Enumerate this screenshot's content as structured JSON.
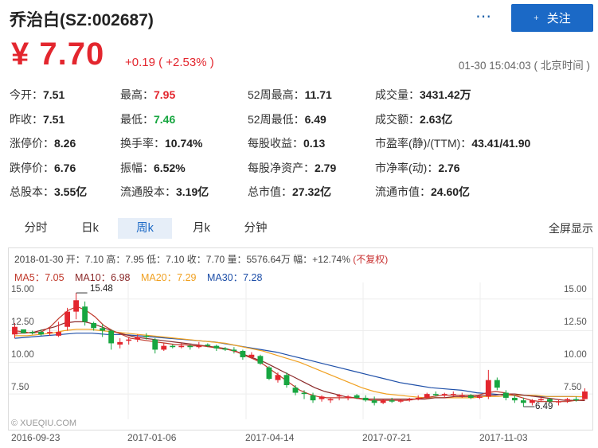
{
  "header": {
    "title": "乔治白(SZ:002687)",
    "more_icon": "⋯",
    "follow_label": "关注",
    "follow_icon": "+",
    "price": "¥ 7.70",
    "change": "+0.19 ( +2.53% )",
    "time": "01-30 15:04:03 ( 北京时间 )"
  },
  "stats": [
    [
      [
        "今开：",
        "7.51",
        ""
      ],
      [
        "最高：",
        "7.95",
        "red"
      ],
      [
        "52周最高：",
        "11.71",
        ""
      ],
      [
        "成交量：",
        "3431.42万",
        ""
      ]
    ],
    [
      [
        "昨收：",
        "7.51",
        ""
      ],
      [
        "最低：",
        "7.46",
        "grn"
      ],
      [
        "52周最低：",
        "6.49",
        ""
      ],
      [
        "成交额：",
        "2.63亿",
        ""
      ]
    ],
    [
      [
        "涨停价：",
        "8.26",
        ""
      ],
      [
        "换手率：",
        "10.74%",
        ""
      ],
      [
        "每股收益：",
        "0.13",
        ""
      ],
      [
        "市盈率(静)/(TTM)：",
        "43.41/41.90",
        ""
      ]
    ],
    [
      [
        "跌停价：",
        "6.76",
        ""
      ],
      [
        "振幅：",
        "6.52%",
        ""
      ],
      [
        "每股净资产：",
        "2.79",
        ""
      ],
      [
        "市净率(动)：",
        "2.76",
        ""
      ]
    ],
    [
      [
        "总股本：",
        "3.55亿",
        ""
      ],
      [
        "流通股本：",
        "3.19亿",
        ""
      ],
      [
        "总市值：",
        "27.32亿",
        ""
      ],
      [
        "流通市值：",
        "24.60亿",
        ""
      ]
    ]
  ],
  "tabs": [
    "分时",
    "日k",
    "周k",
    "月k",
    "分钟"
  ],
  "active_tab": "周k",
  "fullscreen": "全屏显示",
  "chart_info": {
    "line": "2018-01-30 开：7.10 高：7.95 低：7.10 收：7.70 量：5576.64万 幅：+12.74%",
    "adjust": "(不复权)",
    "ma": [
      {
        "label": "MA5：7.05",
        "color": "#c0392b"
      },
      {
        "label": "MA10：6.98",
        "color": "#8b2a2a"
      },
      {
        "label": "MA20：7.29",
        "color": "#f0a020"
      },
      {
        "label": "MA30：7.28",
        "color": "#1e4fa8"
      }
    ],
    "watermark": "© XUEQIU.COM",
    "max_label": "15.48",
    "min_label": "6.49"
  },
  "chart_data": {
    "type": "candlestick",
    "y_ticks": [
      "15.00",
      "12.50",
      "10.00",
      "7.50"
    ],
    "ylim": [
      5.5,
      16.3
    ],
    "x_ticks": [
      "2016-09-23",
      "2017-01-06",
      "2017-04-14",
      "2017-07-21",
      "2017-11-03"
    ],
    "colors": {
      "up": "#e3262e",
      "down": "#17a640",
      "ma5": "#c0392b",
      "ma10": "#8b2a2a",
      "ma20": "#f0a020",
      "ma30": "#1e4fa8"
    },
    "candles": [
      [
        12.2,
        13.1,
        11.9,
        12.8
      ],
      [
        12.6,
        12.5,
        12.3,
        12.3
      ],
      [
        12.4,
        12.5,
        12.2,
        12.3
      ],
      [
        12.4,
        12.6,
        12.1,
        12.2
      ],
      [
        12.3,
        12.7,
        12.1,
        12.4
      ],
      [
        12.1,
        13.2,
        12.0,
        12.4
      ],
      [
        12.8,
        14.3,
        12.5,
        14.0
      ],
      [
        14.0,
        15.48,
        13.4,
        14.9
      ],
      [
        14.4,
        14.8,
        12.9,
        13.2
      ],
      [
        13.1,
        13.2,
        12.5,
        12.7
      ],
      [
        12.7,
        13.0,
        12.0,
        12.5
      ],
      [
        12.5,
        12.6,
        11.0,
        11.5
      ],
      [
        11.4,
        11.9,
        11.1,
        11.6
      ],
      [
        11.7,
        12.0,
        11.4,
        11.8
      ],
      [
        11.8,
        12.2,
        11.6,
        12.0
      ],
      [
        12.1,
        12.3,
        11.8,
        12.0
      ],
      [
        11.8,
        11.9,
        10.7,
        11.0
      ],
      [
        11.0,
        11.5,
        10.9,
        11.3
      ],
      [
        11.3,
        11.4,
        11.1,
        11.2
      ],
      [
        11.2,
        11.5,
        11.1,
        11.3
      ],
      [
        11.3,
        11.4,
        11.0,
        11.2
      ],
      [
        11.2,
        11.6,
        11.1,
        11.3
      ],
      [
        11.4,
        11.5,
        11.2,
        11.3
      ],
      [
        11.3,
        11.4,
        10.9,
        11.1
      ],
      [
        11.1,
        11.2,
        10.9,
        11.0
      ],
      [
        11.0,
        11.2,
        10.7,
        10.9
      ],
      [
        10.9,
        11.0,
        10.2,
        10.4
      ],
      [
        10.4,
        10.8,
        10.3,
        10.6
      ],
      [
        10.5,
        10.6,
        9.8,
        9.9
      ],
      [
        9.6,
        9.7,
        8.6,
        8.7
      ],
      [
        8.6,
        9.2,
        8.4,
        9.0
      ],
      [
        9.0,
        9.2,
        8.0,
        8.2
      ],
      [
        8.0,
        8.2,
        7.4,
        7.6
      ],
      [
        7.6,
        7.8,
        7.1,
        7.5
      ],
      [
        7.4,
        7.6,
        6.8,
        7.0
      ],
      [
        7.1,
        7.4,
        6.9,
        7.3
      ],
      [
        7.0,
        7.2,
        6.8,
        7.1
      ],
      [
        7.3,
        7.5,
        7.0,
        7.4
      ],
      [
        7.2,
        7.4,
        7.0,
        7.3
      ],
      [
        7.4,
        7.5,
        7.1,
        7.2
      ],
      [
        7.2,
        7.4,
        6.9,
        7.0
      ],
      [
        7.0,
        7.3,
        6.6,
        6.8
      ],
      [
        6.8,
        7.1,
        6.7,
        7.0
      ],
      [
        7.0,
        7.2,
        6.8,
        6.9
      ],
      [
        6.9,
        7.1,
        6.8,
        7.0
      ],
      [
        7.0,
        7.2,
        6.9,
        7.1
      ],
      [
        7.1,
        7.4,
        7.0,
        7.2
      ],
      [
        7.2,
        7.6,
        7.1,
        7.5
      ],
      [
        7.5,
        7.7,
        7.3,
        7.4
      ],
      [
        7.4,
        7.6,
        7.2,
        7.5
      ],
      [
        7.5,
        7.7,
        7.3,
        7.5
      ],
      [
        7.4,
        7.6,
        7.2,
        7.4
      ],
      [
        7.4,
        7.5,
        7.1,
        7.2
      ],
      [
        7.2,
        7.4,
        7.1,
        7.3
      ],
      [
        7.3,
        9.4,
        7.1,
        8.6
      ],
      [
        8.6,
        8.8,
        7.8,
        8.0
      ],
      [
        7.6,
        7.8,
        7.0,
        7.2
      ],
      [
        7.2,
        7.4,
        6.8,
        7.0
      ],
      [
        7.0,
        7.2,
        6.5,
        6.8
      ],
      [
        6.8,
        7.1,
        6.6,
        7.0
      ],
      [
        7.0,
        7.3,
        6.9,
        7.1
      ],
      [
        7.1,
        7.2,
        6.8,
        6.9
      ],
      [
        6.9,
        7.1,
        6.6,
        6.9
      ],
      [
        7.0,
        7.2,
        6.8,
        7.1
      ],
      [
        7.1,
        7.3,
        6.9,
        7.0
      ],
      [
        7.1,
        7.95,
        7.1,
        7.7
      ]
    ],
    "ma": {
      "ma5": [
        12.5,
        12.4,
        12.3,
        12.4,
        12.8,
        13.5,
        14.1,
        14.4,
        14.1,
        13.6,
        12.9,
        12.5,
        12.2,
        11.9,
        11.8,
        11.7,
        11.6,
        11.5,
        11.4,
        11.4,
        11.3,
        11.3,
        11.2,
        11.1,
        11.0,
        10.8,
        10.5,
        10.2,
        9.8,
        9.3,
        8.8,
        8.3,
        7.8,
        7.5,
        7.3,
        7.2,
        7.2,
        7.2,
        7.2,
        7.1,
        7.0,
        7.0,
        7.0,
        7.0,
        7.0,
        7.1,
        7.2,
        7.3,
        7.4,
        7.4,
        7.4,
        7.4,
        7.4,
        7.6,
        7.7,
        7.6,
        7.4,
        7.2,
        7.0,
        6.9,
        6.9,
        6.9,
        6.9,
        7.0,
        7.05
      ],
      "ma10": [
        12.3,
        12.3,
        12.4,
        12.6,
        12.8,
        13.1,
        13.2,
        13.2,
        13.0,
        12.7,
        12.4,
        12.2,
        12.0,
        11.9,
        11.8,
        11.7,
        11.6,
        11.5,
        11.4,
        11.3,
        11.2,
        11.1,
        10.9,
        10.6,
        10.3,
        10.0,
        9.6,
        9.2,
        8.8,
        8.4,
        8.0,
        7.7,
        7.5,
        7.3,
        7.2,
        7.1,
        7.1,
        7.1,
        7.1,
        7.1,
        7.1,
        7.1,
        7.2,
        7.2,
        7.3,
        7.3,
        7.3,
        7.4,
        7.4,
        7.5,
        7.5,
        7.4,
        7.3,
        7.2,
        7.1,
        7.0,
        7.0,
        6.98
      ],
      "ma20": [
        12.1,
        12.1,
        12.2,
        12.3,
        12.5,
        12.6,
        12.6,
        12.5,
        12.4,
        12.3,
        12.2,
        12.1,
        12.0,
        11.9,
        11.8,
        11.7,
        11.6,
        11.5,
        11.3,
        11.1,
        10.9,
        10.6,
        10.3,
        10.0,
        9.6,
        9.2,
        8.8,
        8.4,
        8.0,
        7.7,
        7.5,
        7.4,
        7.3,
        7.2,
        7.2,
        7.2,
        7.2,
        7.2,
        7.3,
        7.3,
        7.4,
        7.4,
        7.4,
        7.3,
        7.3,
        7.3,
        7.29
      ],
      "ma30": [
        11.9,
        12.0,
        12.1,
        12.2,
        12.3,
        12.3,
        12.2,
        12.2,
        12.1,
        12.0,
        11.9,
        11.8,
        11.7,
        11.6,
        11.4,
        11.2,
        11.0,
        10.8,
        10.5,
        10.2,
        9.9,
        9.6,
        9.3,
        9.0,
        8.7,
        8.4,
        8.2,
        8.0,
        7.9,
        7.8,
        7.6,
        7.5,
        7.4,
        7.4,
        7.3,
        7.3,
        7.3,
        7.28
      ]
    }
  }
}
